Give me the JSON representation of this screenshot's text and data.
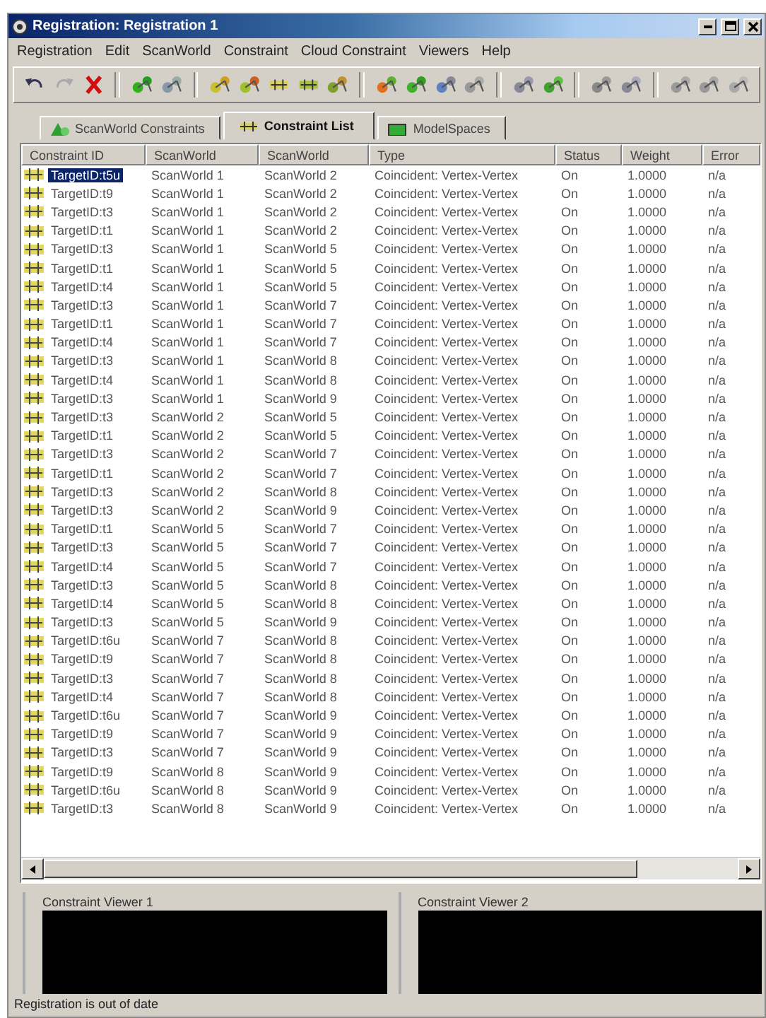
{
  "window": {
    "title": "Registration: Registration 1"
  },
  "menu": [
    "Registration",
    "Edit",
    "ScanWorld",
    "Constraint",
    "Cloud Constraint",
    "Viewers",
    "Help"
  ],
  "tabs": [
    {
      "label": "ScanWorld Constraints",
      "selected": false
    },
    {
      "label": "Constraint List",
      "selected": true
    },
    {
      "label": "ModelSpaces",
      "selected": false
    }
  ],
  "table": {
    "columns": [
      "Constraint ID",
      "ScanWorld",
      "ScanWorld",
      "Type",
      "Status",
      "Weight",
      "Error"
    ],
    "rows": [
      {
        "cells": [
          "TargetID:t5u",
          "ScanWorld 1",
          "ScanWorld 2",
          "Coincident: Vertex-Vertex",
          "On",
          "1.0000",
          "n/a"
        ],
        "selected": true
      },
      {
        "cells": [
          "TargetID:t9",
          "ScanWorld 1",
          "ScanWorld 2",
          "Coincident: Vertex-Vertex",
          "On",
          "1.0000",
          "n/a"
        ],
        "selected": false
      },
      {
        "cells": [
          "TargetID:t3",
          "ScanWorld 1",
          "ScanWorld 2",
          "Coincident: Vertex-Vertex",
          "On",
          "1.0000",
          "n/a"
        ],
        "selected": false
      },
      {
        "cells": [
          "TargetID:t1",
          "ScanWorld 1",
          "ScanWorld 2",
          "Coincident: Vertex-Vertex",
          "On",
          "1.0000",
          "n/a"
        ],
        "selected": false
      },
      {
        "cells": [
          "TargetID:t3",
          "ScanWorld 1",
          "ScanWorld 5",
          "Coincident: Vertex-Vertex",
          "On",
          "1.0000",
          "n/a"
        ],
        "selected": false
      },
      {
        "cells": [
          "TargetID:t1",
          "ScanWorld 1",
          "ScanWorld 5",
          "Coincident: Vertex-Vertex",
          "On",
          "1.0000",
          "n/a"
        ],
        "selected": false
      },
      {
        "cells": [
          "TargetID:t4",
          "ScanWorld 1",
          "ScanWorld 5",
          "Coincident: Vertex-Vertex",
          "On",
          "1.0000",
          "n/a"
        ],
        "selected": false
      },
      {
        "cells": [
          "TargetID:t3",
          "ScanWorld 1",
          "ScanWorld 7",
          "Coincident: Vertex-Vertex",
          "On",
          "1.0000",
          "n/a"
        ],
        "selected": false
      },
      {
        "cells": [
          "TargetID:t1",
          "ScanWorld 1",
          "ScanWorld 7",
          "Coincident: Vertex-Vertex",
          "On",
          "1.0000",
          "n/a"
        ],
        "selected": false
      },
      {
        "cells": [
          "TargetID:t4",
          "ScanWorld 1",
          "ScanWorld 7",
          "Coincident: Vertex-Vertex",
          "On",
          "1.0000",
          "n/a"
        ],
        "selected": false
      },
      {
        "cells": [
          "TargetID:t3",
          "ScanWorld 1",
          "ScanWorld 8",
          "Coincident: Vertex-Vertex",
          "On",
          "1.0000",
          "n/a"
        ],
        "selected": false
      },
      {
        "cells": [
          "TargetID:t4",
          "ScanWorld 1",
          "ScanWorld 8",
          "Coincident: Vertex-Vertex",
          "On",
          "1.0000",
          "n/a"
        ],
        "selected": false
      },
      {
        "cells": [
          "TargetID:t3",
          "ScanWorld 1",
          "ScanWorld 9",
          "Coincident: Vertex-Vertex",
          "On",
          "1.0000",
          "n/a"
        ],
        "selected": false
      },
      {
        "cells": [
          "TargetID:t3",
          "ScanWorld 2",
          "ScanWorld 5",
          "Coincident: Vertex-Vertex",
          "On",
          "1.0000",
          "n/a"
        ],
        "selected": false
      },
      {
        "cells": [
          "TargetID:t1",
          "ScanWorld 2",
          "ScanWorld 5",
          "Coincident: Vertex-Vertex",
          "On",
          "1.0000",
          "n/a"
        ],
        "selected": false
      },
      {
        "cells": [
          "TargetID:t3",
          "ScanWorld 2",
          "ScanWorld 7",
          "Coincident: Vertex-Vertex",
          "On",
          "1.0000",
          "n/a"
        ],
        "selected": false
      },
      {
        "cells": [
          "TargetID:t1",
          "ScanWorld 2",
          "ScanWorld 7",
          "Coincident: Vertex-Vertex",
          "On",
          "1.0000",
          "n/a"
        ],
        "selected": false
      },
      {
        "cells": [
          "TargetID:t3",
          "ScanWorld 2",
          "ScanWorld 8",
          "Coincident: Vertex-Vertex",
          "On",
          "1.0000",
          "n/a"
        ],
        "selected": false
      },
      {
        "cells": [
          "TargetID:t3",
          "ScanWorld 2",
          "ScanWorld 9",
          "Coincident: Vertex-Vertex",
          "On",
          "1.0000",
          "n/a"
        ],
        "selected": false
      },
      {
        "cells": [
          "TargetID:t1",
          "ScanWorld 5",
          "ScanWorld 7",
          "Coincident: Vertex-Vertex",
          "On",
          "1.0000",
          "n/a"
        ],
        "selected": false
      },
      {
        "cells": [
          "TargetID:t3",
          "ScanWorld 5",
          "ScanWorld 7",
          "Coincident: Vertex-Vertex",
          "On",
          "1.0000",
          "n/a"
        ],
        "selected": false
      },
      {
        "cells": [
          "TargetID:t4",
          "ScanWorld 5",
          "ScanWorld 7",
          "Coincident: Vertex-Vertex",
          "On",
          "1.0000",
          "n/a"
        ],
        "selected": false
      },
      {
        "cells": [
          "TargetID:t3",
          "ScanWorld 5",
          "ScanWorld 8",
          "Coincident: Vertex-Vertex",
          "On",
          "1.0000",
          "n/a"
        ],
        "selected": false
      },
      {
        "cells": [
          "TargetID:t4",
          "ScanWorld 5",
          "ScanWorld 8",
          "Coincident: Vertex-Vertex",
          "On",
          "1.0000",
          "n/a"
        ],
        "selected": false
      },
      {
        "cells": [
          "TargetID:t3",
          "ScanWorld 5",
          "ScanWorld 9",
          "Coincident: Vertex-Vertex",
          "On",
          "1.0000",
          "n/a"
        ],
        "selected": false
      },
      {
        "cells": [
          "TargetID:t6u",
          "ScanWorld 7",
          "ScanWorld 8",
          "Coincident: Vertex-Vertex",
          "On",
          "1.0000",
          "n/a"
        ],
        "selected": false
      },
      {
        "cells": [
          "TargetID:t9",
          "ScanWorld 7",
          "ScanWorld 8",
          "Coincident: Vertex-Vertex",
          "On",
          "1.0000",
          "n/a"
        ],
        "selected": false
      },
      {
        "cells": [
          "TargetID:t3",
          "ScanWorld 7",
          "ScanWorld 8",
          "Coincident: Vertex-Vertex",
          "On",
          "1.0000",
          "n/a"
        ],
        "selected": false
      },
      {
        "cells": [
          "TargetID:t4",
          "ScanWorld 7",
          "ScanWorld 8",
          "Coincident: Vertex-Vertex",
          "On",
          "1.0000",
          "n/a"
        ],
        "selected": false
      },
      {
        "cells": [
          "TargetID:t6u",
          "ScanWorld 7",
          "ScanWorld 9",
          "Coincident: Vertex-Vertex",
          "On",
          "1.0000",
          "n/a"
        ],
        "selected": false
      },
      {
        "cells": [
          "TargetID:t9",
          "ScanWorld 7",
          "ScanWorld 9",
          "Coincident: Vertex-Vertex",
          "On",
          "1.0000",
          "n/a"
        ],
        "selected": false
      },
      {
        "cells": [
          "TargetID:t3",
          "ScanWorld 7",
          "ScanWorld 9",
          "Coincident: Vertex-Vertex",
          "On",
          "1.0000",
          "n/a"
        ],
        "selected": false
      },
      {
        "cells": [
          "TargetID:t9",
          "ScanWorld 8",
          "ScanWorld 9",
          "Coincident: Vertex-Vertex",
          "On",
          "1.0000",
          "n/a"
        ],
        "selected": false
      },
      {
        "cells": [
          "TargetID:t6u",
          "ScanWorld 8",
          "ScanWorld 9",
          "Coincident: Vertex-Vertex",
          "On",
          "1.0000",
          "n/a"
        ],
        "selected": false
      },
      {
        "cells": [
          "TargetID:t3",
          "ScanWorld 8",
          "ScanWorld 9",
          "Coincident: Vertex-Vertex",
          "On",
          "1.0000",
          "n/a"
        ],
        "selected": false
      }
    ]
  },
  "viewers": [
    {
      "title": "Constraint Viewer 1"
    },
    {
      "title": "Constraint Viewer 2"
    }
  ],
  "status_bar": "Registration is out of date"
}
